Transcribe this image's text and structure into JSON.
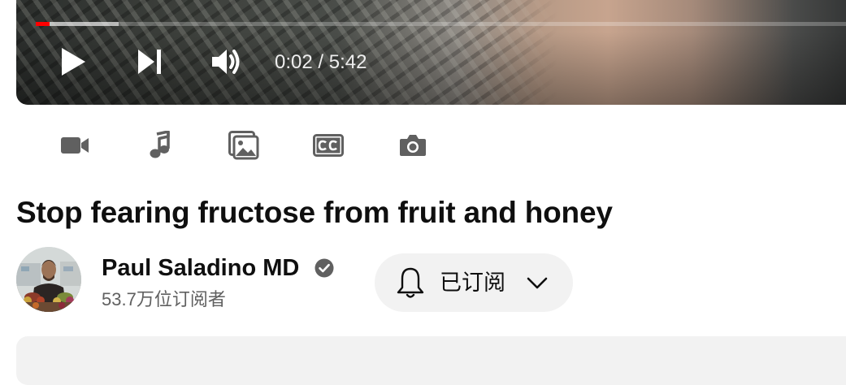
{
  "player": {
    "time_display": "0:02 / 5:42",
    "progress_played_fraction": 0.0035,
    "progress_buffered_fraction": 0.1,
    "accent_color": "#ff0000",
    "controls": {
      "play": "play-icon",
      "next": "skip-next-icon",
      "volume": "volume-icon"
    }
  },
  "toolbar": {
    "items": [
      {
        "icon": "video-camera-icon"
      },
      {
        "icon": "music-note-icon"
      },
      {
        "icon": "image-gallery-icon"
      },
      {
        "icon": "closed-captions-icon"
      },
      {
        "icon": "camera-icon"
      }
    ]
  },
  "video": {
    "title": "Stop fearing fructose from fruit and honey"
  },
  "channel": {
    "name": "Paul Saladino MD",
    "verified_icon": "verified-check-icon",
    "subscribers": "53.7万位订阅者",
    "subscribe_button_label": "已订阅",
    "subscribe_button_icons": [
      "bell-icon",
      "chevron-down-icon"
    ]
  }
}
